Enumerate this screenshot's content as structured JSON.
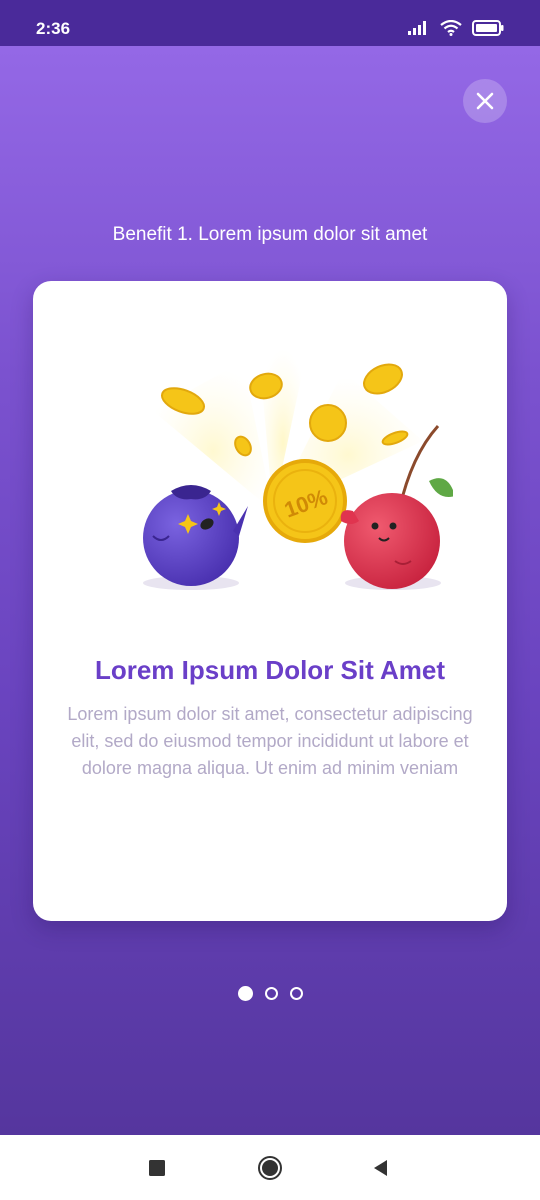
{
  "status_bar": {
    "time": "2:36",
    "icons": [
      "signal-icon",
      "wifi-icon",
      "battery-icon"
    ]
  },
  "header": {
    "close_icon": "close-icon",
    "benefit_title": "Benefit 1. Lorem ipsum dolor sit amet"
  },
  "card": {
    "coin_label": "10%",
    "title": "Lorem Ipsum Dolor Sit Amet",
    "description": "Lorem ipsum dolor sit amet, consectetur adipiscing elit, sed do eiusmod tempor incididunt ut labore et dolore magna aliqua. Ut enim ad minim veniam"
  },
  "pagination": {
    "total": 3,
    "active": 1
  },
  "nav_bar": {
    "buttons": [
      "recent-apps-icon",
      "home-icon",
      "back-icon"
    ]
  },
  "colors": {
    "accent": "#6a3fc8",
    "background_top": "#9468e6",
    "background_bottom": "#55369e",
    "status_bar": "#4a2a9a",
    "coin": "#f5c518",
    "blueberry": "#5b3fc4",
    "cherry": "#e0344f"
  }
}
